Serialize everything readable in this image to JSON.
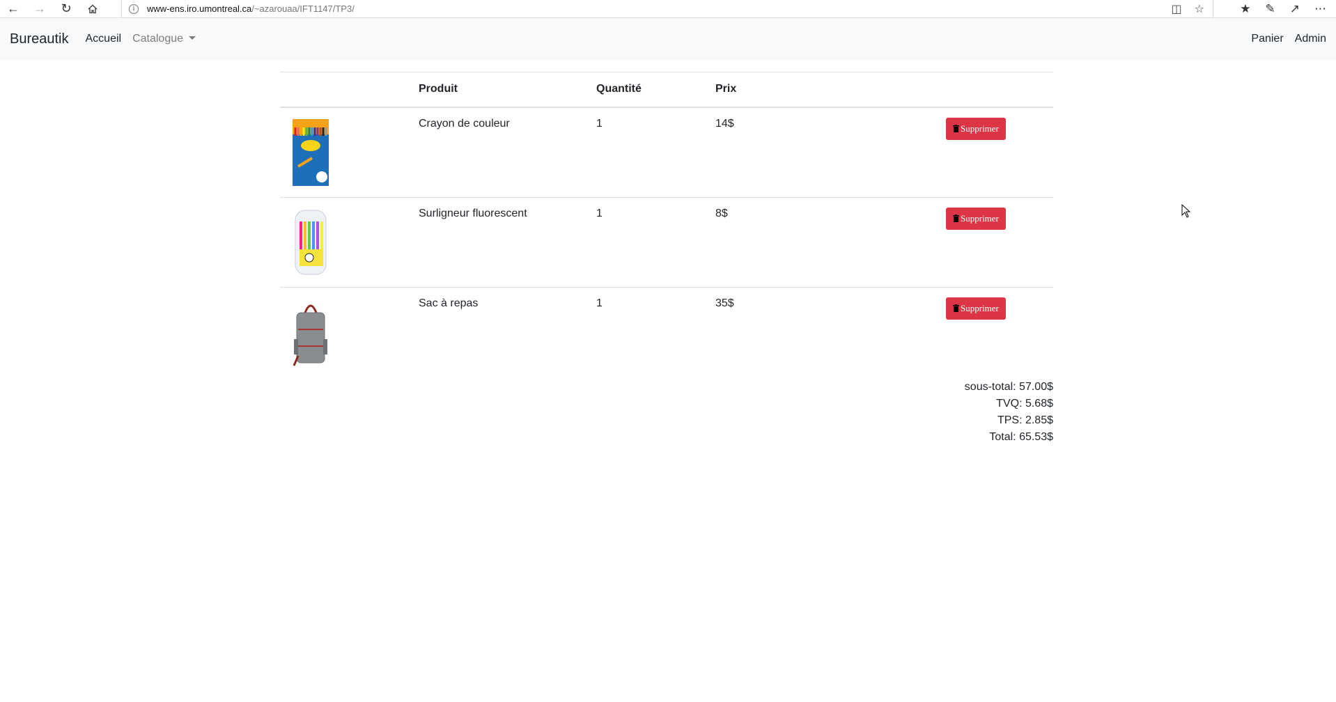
{
  "browser": {
    "url_host": "www-ens.iro.umontreal.ca",
    "url_path": "/~azarouaa/IFT1147/TP3/"
  },
  "navbar": {
    "brand": "Bureautik",
    "home": "Accueil",
    "catalog": "Catalogue",
    "cart": "Panier",
    "admin": "Admin"
  },
  "table": {
    "headers": [
      "",
      "Produit",
      "Quantité",
      "Prix",
      ""
    ],
    "rows": [
      {
        "name": "Crayon de couleur",
        "qty": "1",
        "price": "14$",
        "delete": "Supprimer",
        "image_icon": "colored-pencils-image"
      },
      {
        "name": "Surligneur fluorescent",
        "qty": "1",
        "price": "8$",
        "delete": "Supprimer",
        "image_icon": "highlighters-image"
      },
      {
        "name": "Sac à repas",
        "qty": "1",
        "price": "35$",
        "delete": "Supprimer",
        "image_icon": "lunch-bag-image"
      }
    ]
  },
  "totals": {
    "subtotal": "sous-total: 57.00$",
    "tvq": "TVQ: 5.68$",
    "tps": "TPS: 2.85$",
    "total": "Total: 65.53$"
  },
  "colors": {
    "danger": "#dc3545",
    "navbar_bg": "#f8f9fa"
  }
}
